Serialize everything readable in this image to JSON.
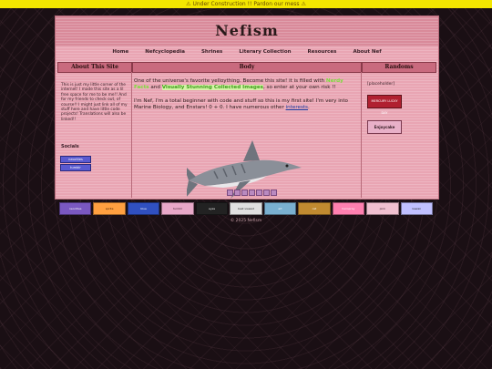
{
  "banner": "⚠ Under Construction !! Pardon our mess ⚠",
  "site_title": "Nefism",
  "nav": [
    "Home",
    "Nefcyclopedia",
    "Shrines",
    "Literary Collection",
    "Resources",
    "About Nef"
  ],
  "columns": {
    "left_header": "About This Site",
    "mid_header": "Body",
    "right_header": "Randoms"
  },
  "about_text": "This is just my little corner of the internet! I made this site as a lil free space for me to be me!! And for my friends to check out, of course!! I might just link all of my stuff here and have little code projects! Translations will also be linked!!",
  "socials": {
    "title": "Socials",
    "items": [
      "neocities",
      "tumblr"
    ]
  },
  "body": {
    "intro_a": "One of the universe's favorite yelloything. Become this site! it is filled with",
    "link_nerdy": "Nerdy Facts",
    "and": "and",
    "link_collection": "Visually Stunning Collected Images",
    "intro_b": ", so enter at your own risk !!",
    "para2": "I'm Nef, I'm a total beginner with code and stuff so this is my first site! I'm very into Marine Biology, and Enstars! 0 + 0. I have numerous other",
    "link_interests": "interests",
    "para2_end": "."
  },
  "randoms": {
    "placeholder": "[placeholder]",
    "box1": "MERCURY LUCKY DAY",
    "box2": "Enjoycake"
  },
  "footer_buttons": [
    "neocities",
    "sprite",
    "blue",
    "tumblr",
    "eyes",
    "best viewed",
    "art",
    "cat",
    "hairspray",
    "pink",
    "kawaii"
  ],
  "copyright": "© 2025 Nefism",
  "colors": {
    "banner": "#f3e600",
    "main_bg": "#e9a5b3",
    "header_bg": "#d98a9a",
    "col_head": "#c96a7e"
  }
}
